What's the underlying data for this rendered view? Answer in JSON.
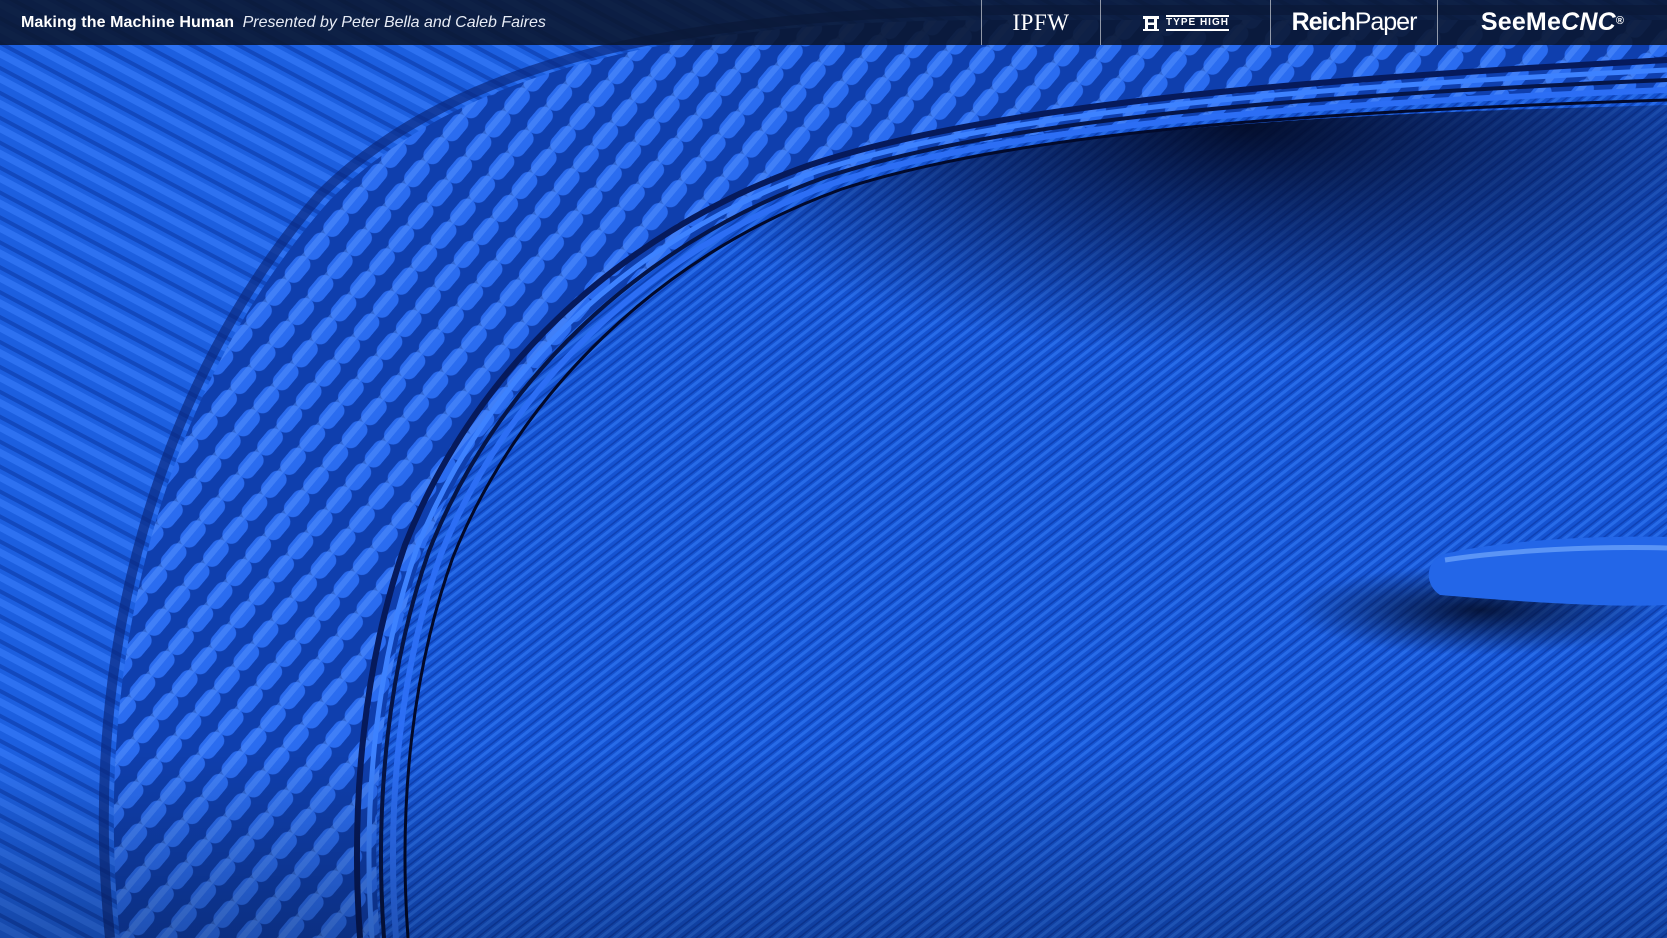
{
  "header": {
    "title": "Making the Machine Human",
    "subtitle": "Presented by Peter Bella and Caleb Faires"
  },
  "sponsors": {
    "ipfw": "IPFW",
    "typehigh": "TYPE HIGH",
    "reich_bold": "Reich",
    "reich_light": "Paper",
    "seeme_prefix": "SeeMe",
    "seeme_cnc": "CNC",
    "seeme_mark": "®"
  },
  "colors": {
    "print_blue": "#1a5bdc",
    "shadow_navy": "#05123a",
    "header_bg": "#0a162d"
  }
}
